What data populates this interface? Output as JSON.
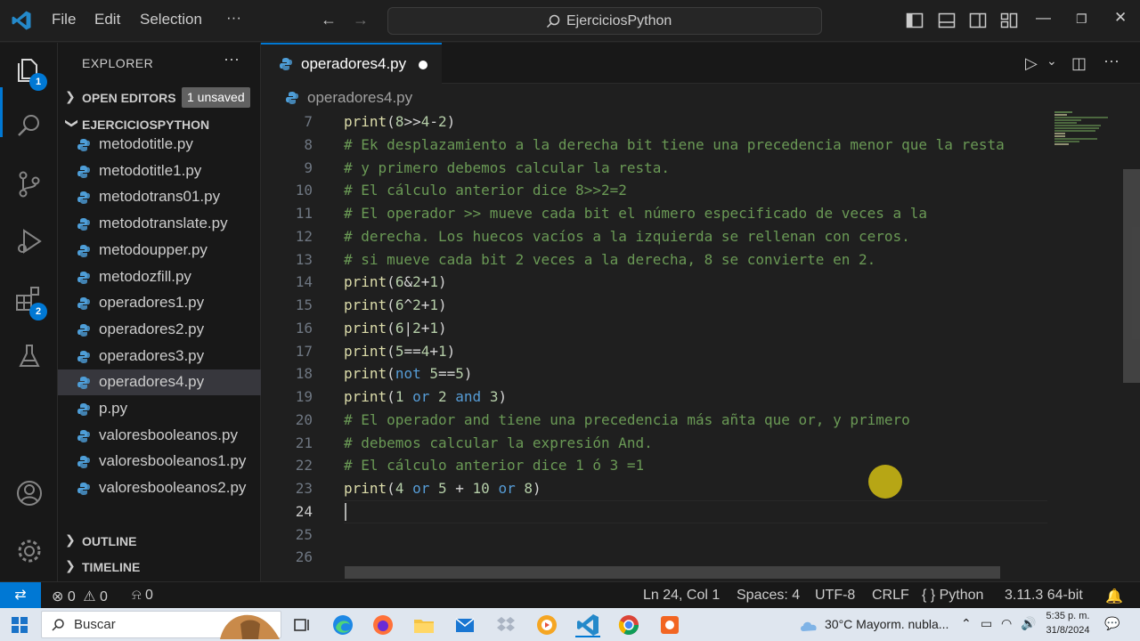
{
  "titlebar": {
    "menu": [
      "File",
      "Edit",
      "Selection",
      "···"
    ],
    "back_label": "←",
    "forward_label": "→",
    "search_text": "EjerciciosPython",
    "window_controls": {
      "minimize": "—",
      "restore": "❐",
      "close": "✕"
    }
  },
  "activity_bar": {
    "items": [
      {
        "name": "explorer",
        "badge": "1"
      },
      {
        "name": "search"
      },
      {
        "name": "source-control"
      },
      {
        "name": "run-debug"
      },
      {
        "name": "extensions",
        "badge": "2"
      },
      {
        "name": "testing"
      }
    ],
    "bottom": [
      "accounts",
      "manage"
    ]
  },
  "sidebar": {
    "title": "EXPLORER",
    "more": "···",
    "open_editors": {
      "label": "OPEN EDITORS",
      "badge": "1 unsaved"
    },
    "folder": {
      "label": "EJERCICIOSPYTHON"
    },
    "files": [
      "metodotitle.py",
      "metodotitle1.py",
      "metodotrans01.py",
      "metodotranslate.py",
      "metodoupper.py",
      "metodozfill.py",
      "operadores1.py",
      "operadores2.py",
      "operadores3.py",
      "operadores4.py",
      "p.py",
      "valoresbooleanos.py",
      "valoresbooleanos1.py",
      "valoresbooleanos2.py"
    ],
    "active_file": "operadores4.py",
    "outline": "OUTLINE",
    "timeline": "TIMELINE"
  },
  "editor": {
    "tab": {
      "name": "operadores4.py",
      "dirty": true
    },
    "breadcrumb": "operadores4.py",
    "line_numbers": [
      "7",
      "8",
      "9",
      "10",
      "11",
      "12",
      "13",
      "14",
      "15",
      "16",
      "17",
      "18",
      "19",
      "20",
      "21",
      "22",
      "23",
      "24",
      "25",
      "26"
    ],
    "current_line": "24",
    "lines": [
      [
        [
          "fn",
          "print"
        ],
        [
          "pn",
          "("
        ],
        [
          "nm",
          "8"
        ],
        [
          "pn",
          ">>"
        ],
        [
          "nm",
          "4"
        ],
        [
          "pn",
          "-"
        ],
        [
          "nm",
          "2"
        ],
        [
          "pn",
          ")"
        ]
      ],
      [
        [
          "cm",
          "# Ek desplazamiento a la derecha bit tiene una precedencia menor que la resta"
        ]
      ],
      [
        [
          "cm",
          "# y primero debemos calcular la resta."
        ]
      ],
      [
        [
          "cm",
          "# El cálculo anterior dice 8>>2=2"
        ]
      ],
      [
        [
          "cm",
          "# El operador >> mueve cada bit el número especificado de veces a la"
        ]
      ],
      [
        [
          "cm",
          "# derecha. Los huecos vacíos a la izquierda se rellenan con ceros."
        ]
      ],
      [
        [
          "cm",
          "# si mueve cada bit 2 veces a la derecha, 8 se convierte en 2."
        ]
      ],
      [
        [
          "fn",
          "print"
        ],
        [
          "pn",
          "("
        ],
        [
          "nm",
          "6"
        ],
        [
          "pn",
          "&"
        ],
        [
          "nm",
          "2"
        ],
        [
          "pn",
          "+"
        ],
        [
          "nm",
          "1"
        ],
        [
          "pn",
          ")"
        ]
      ],
      [
        [
          "fn",
          "print"
        ],
        [
          "pn",
          "("
        ],
        [
          "nm",
          "6"
        ],
        [
          "pn",
          "^"
        ],
        [
          "nm",
          "2"
        ],
        [
          "pn",
          "+"
        ],
        [
          "nm",
          "1"
        ],
        [
          "pn",
          ")"
        ]
      ],
      [
        [
          "fn",
          "print"
        ],
        [
          "pn",
          "("
        ],
        [
          "nm",
          "6"
        ],
        [
          "pn",
          "|"
        ],
        [
          "nm",
          "2"
        ],
        [
          "pn",
          "+"
        ],
        [
          "nm",
          "1"
        ],
        [
          "pn",
          ")"
        ]
      ],
      [
        [
          "fn",
          "print"
        ],
        [
          "pn",
          "("
        ],
        [
          "nm",
          "5"
        ],
        [
          "pn",
          "=="
        ],
        [
          "nm",
          "4"
        ],
        [
          "pn",
          "+"
        ],
        [
          "nm",
          "1"
        ],
        [
          "pn",
          ")"
        ]
      ],
      [
        [
          "fn",
          "print"
        ],
        [
          "pn",
          "("
        ],
        [
          "op",
          "not"
        ],
        [
          "pn",
          " "
        ],
        [
          "nm",
          "5"
        ],
        [
          "pn",
          "=="
        ],
        [
          "nm",
          "5"
        ],
        [
          "pn",
          ")"
        ]
      ],
      [
        [
          "fn",
          "print"
        ],
        [
          "pn",
          "("
        ],
        [
          "nm",
          "1"
        ],
        [
          "pn",
          " "
        ],
        [
          "op",
          "or"
        ],
        [
          "pn",
          " "
        ],
        [
          "nm",
          "2"
        ],
        [
          "pn",
          " "
        ],
        [
          "op",
          "and"
        ],
        [
          "pn",
          " "
        ],
        [
          "nm",
          "3"
        ],
        [
          "pn",
          ")"
        ]
      ],
      [
        [
          "cm",
          "# El operador and tiene una precedencia más añta que or, y primero"
        ]
      ],
      [
        [
          "cm",
          "# debemos calcular la expresión And."
        ]
      ],
      [
        [
          "cm",
          "# El cálculo anterior dice 1 ó 3 =1"
        ]
      ],
      [
        [
          "fn",
          "print"
        ],
        [
          "pn",
          "("
        ],
        [
          "nm",
          "4"
        ],
        [
          "pn",
          " "
        ],
        [
          "op",
          "or"
        ],
        [
          "pn",
          " "
        ],
        [
          "nm",
          "5"
        ],
        [
          "pn",
          " + "
        ],
        [
          "nm",
          "10"
        ],
        [
          "pn",
          " "
        ],
        [
          "op",
          "or"
        ],
        [
          "pn",
          " "
        ],
        [
          "nm",
          "8"
        ],
        [
          "pn",
          ")"
        ]
      ],
      [],
      [],
      []
    ],
    "actions": {
      "run": "▷",
      "run_menu": "⌄",
      "split": "◫",
      "more": "···"
    }
  },
  "statusbar": {
    "remote": "⇄",
    "errors": "0",
    "warnings": "0",
    "ports": "0",
    "position": "Ln 24, Col 1",
    "spaces": "Spaces: 4",
    "encoding": "UTF-8",
    "eol": "CRLF",
    "language": "Python",
    "interpreter": "3.11.3 64-bit"
  },
  "taskbar": {
    "search_placeholder": "Buscar",
    "weather": "30°C  Mayorm. nubla...",
    "time": "5:35 p. m.",
    "date": "31/8/2024"
  },
  "colors": {
    "accent": "#0078d4",
    "comment": "#6a9955",
    "keyword": "#569cd6",
    "function": "#dcdcaa",
    "number": "#b5cea8"
  }
}
